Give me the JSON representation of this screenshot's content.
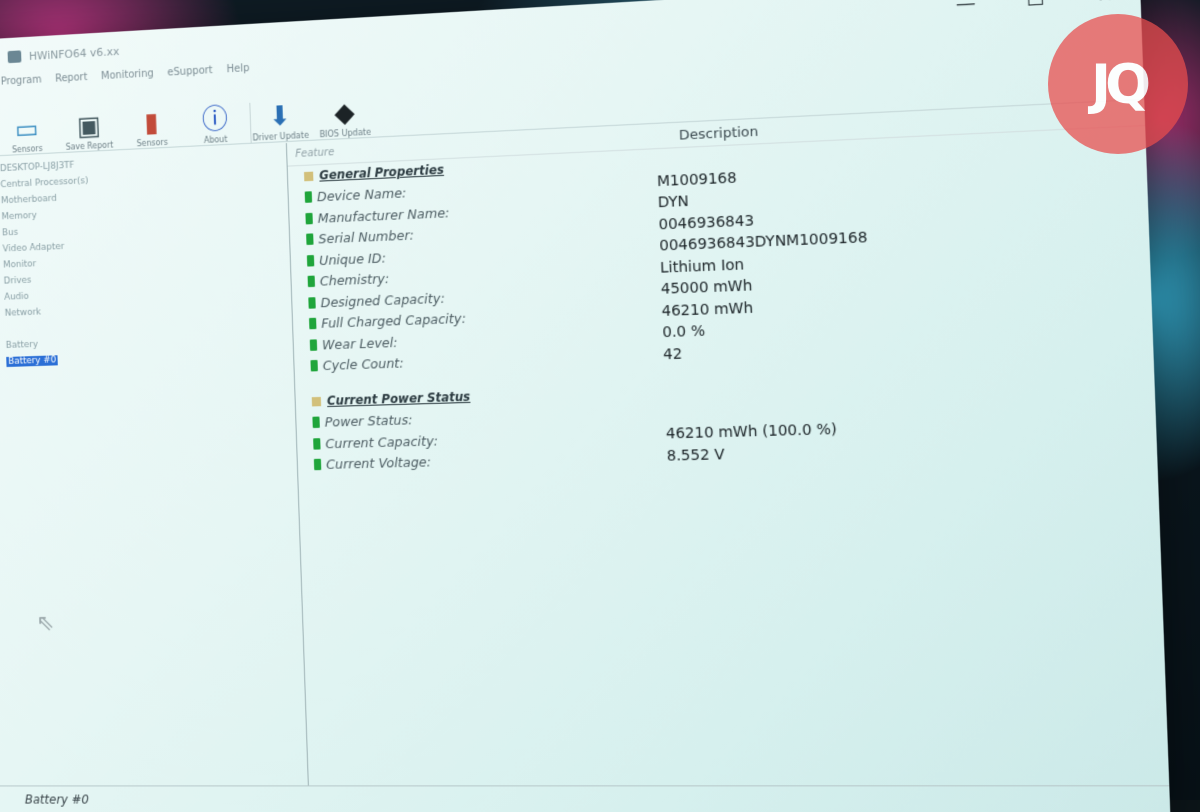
{
  "window": {
    "title": "HWiNFO64 v6.xx",
    "controls": {
      "minimize": "—",
      "maximize": "☐",
      "close": "✕"
    }
  },
  "menu": [
    "Program",
    "Report",
    "Monitoring",
    "eSupport",
    "Help"
  ],
  "toolbar": [
    {
      "label": "Sensors",
      "icon": "monitor-icon"
    },
    {
      "label": "Save Report",
      "icon": "floppy-icon"
    },
    {
      "label": "Sensors",
      "icon": "thermometer-icon"
    },
    {
      "label": "About",
      "icon": "info-icon"
    },
    {
      "label": "Driver Update",
      "icon": "driver-update-icon"
    },
    {
      "label": "BIOS Update",
      "icon": "chip-icon"
    }
  ],
  "tree": [
    {
      "label": "DESKTOP-LJ8J3TF",
      "selected": false
    },
    {
      "label": "Central Processor(s)",
      "selected": false
    },
    {
      "label": "Motherboard",
      "selected": false
    },
    {
      "label": "Memory",
      "selected": false
    },
    {
      "label": "Bus",
      "selected": false
    },
    {
      "label": "Video Adapter",
      "selected": false
    },
    {
      "label": "Monitor",
      "selected": false
    },
    {
      "label": "Drives",
      "selected": false
    },
    {
      "label": "Audio",
      "selected": false
    },
    {
      "label": "Network",
      "selected": false
    },
    {
      "label": "",
      "selected": false
    },
    {
      "label": "Battery",
      "selected": false
    },
    {
      "label": "Battery #0",
      "selected": true
    }
  ],
  "columns": {
    "feature": "Feature",
    "description": "Description"
  },
  "groups": {
    "general": {
      "title": "General Properties",
      "rows": [
        {
          "feature": "Device Name:",
          "value": "M1009168"
        },
        {
          "feature": "Manufacturer Name:",
          "value": "DYN"
        },
        {
          "feature": "Serial Number:",
          "value": "0046936843"
        },
        {
          "feature": "Unique ID:",
          "value": "0046936843DYNM1009168"
        },
        {
          "feature": "Chemistry:",
          "value": "Lithium Ion"
        },
        {
          "feature": "Designed Capacity:",
          "value": "45000 mWh"
        },
        {
          "feature": "Full Charged Capacity:",
          "value": "46210 mWh"
        },
        {
          "feature": "Wear Level:",
          "value": "0.0 %"
        },
        {
          "feature": "Cycle Count:",
          "value": "42"
        }
      ]
    },
    "power": {
      "title": "Current Power Status",
      "rows": [
        {
          "feature": "Power Status:",
          "value": ""
        },
        {
          "feature": "Current Capacity:",
          "value": "46210 mWh (100.0 %)"
        },
        {
          "feature": "Current Voltage:",
          "value": "8.552 V"
        }
      ]
    }
  },
  "statusbar": "Battery #0",
  "watermark": "JQ"
}
